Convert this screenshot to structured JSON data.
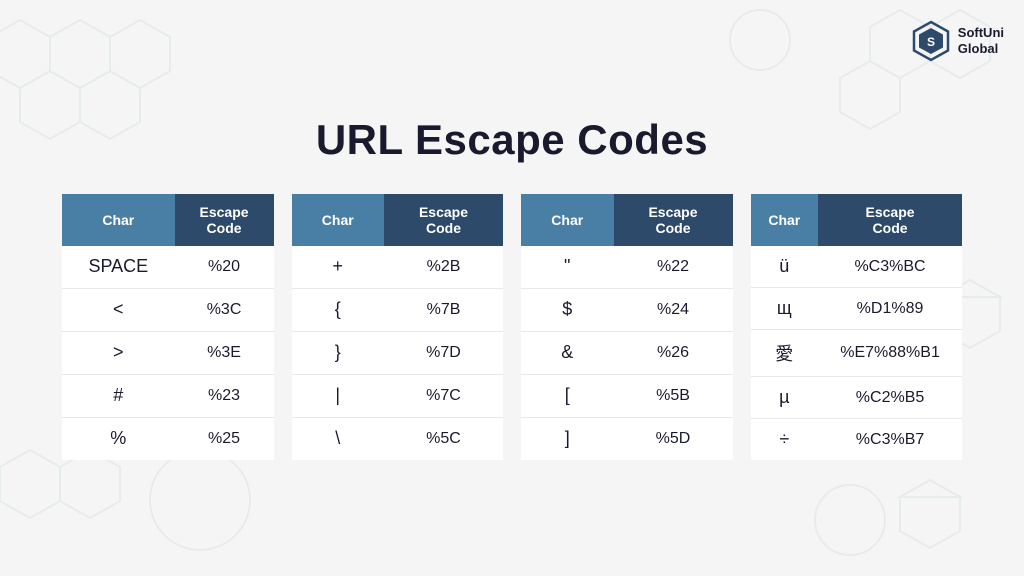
{
  "page": {
    "title": "URL Escape Codes"
  },
  "logo": {
    "name": "SoftUni Global",
    "line1": "SoftUni",
    "line2": "Global"
  },
  "tables": [
    {
      "id": "table1",
      "headers": [
        "Char",
        "Escape Code"
      ],
      "rows": [
        [
          "SPACE",
          "%20"
        ],
        [
          "<",
          "%3C"
        ],
        [
          ">",
          "%3E"
        ],
        [
          "#",
          "%23"
        ],
        [
          "%",
          "%25"
        ]
      ]
    },
    {
      "id": "table2",
      "headers": [
        "Char",
        "Escape Code"
      ],
      "rows": [
        [
          "+",
          "%2B"
        ],
        [
          "{",
          "%7B"
        ],
        [
          "}",
          "%7D"
        ],
        [
          "|",
          "%7C"
        ],
        [
          "\\",
          "%5C"
        ]
      ]
    },
    {
      "id": "table3",
      "headers": [
        "Char",
        "Escape Code"
      ],
      "rows": [
        [
          "\"",
          "%22"
        ],
        [
          "$",
          "%24"
        ],
        [
          "&",
          "%26"
        ],
        [
          "[",
          "%5B"
        ],
        [
          "]",
          "%5D"
        ]
      ]
    },
    {
      "id": "table4",
      "headers": [
        "Char",
        "Escape Code"
      ],
      "rows": [
        [
          "ü",
          "%C3%BC"
        ],
        [
          "щ",
          "%D1%89"
        ],
        [
          "愛",
          "%E7%88%B1"
        ],
        [
          "µ",
          "%C2%B5"
        ],
        [
          "÷",
          "%C3%B7"
        ]
      ]
    }
  ]
}
